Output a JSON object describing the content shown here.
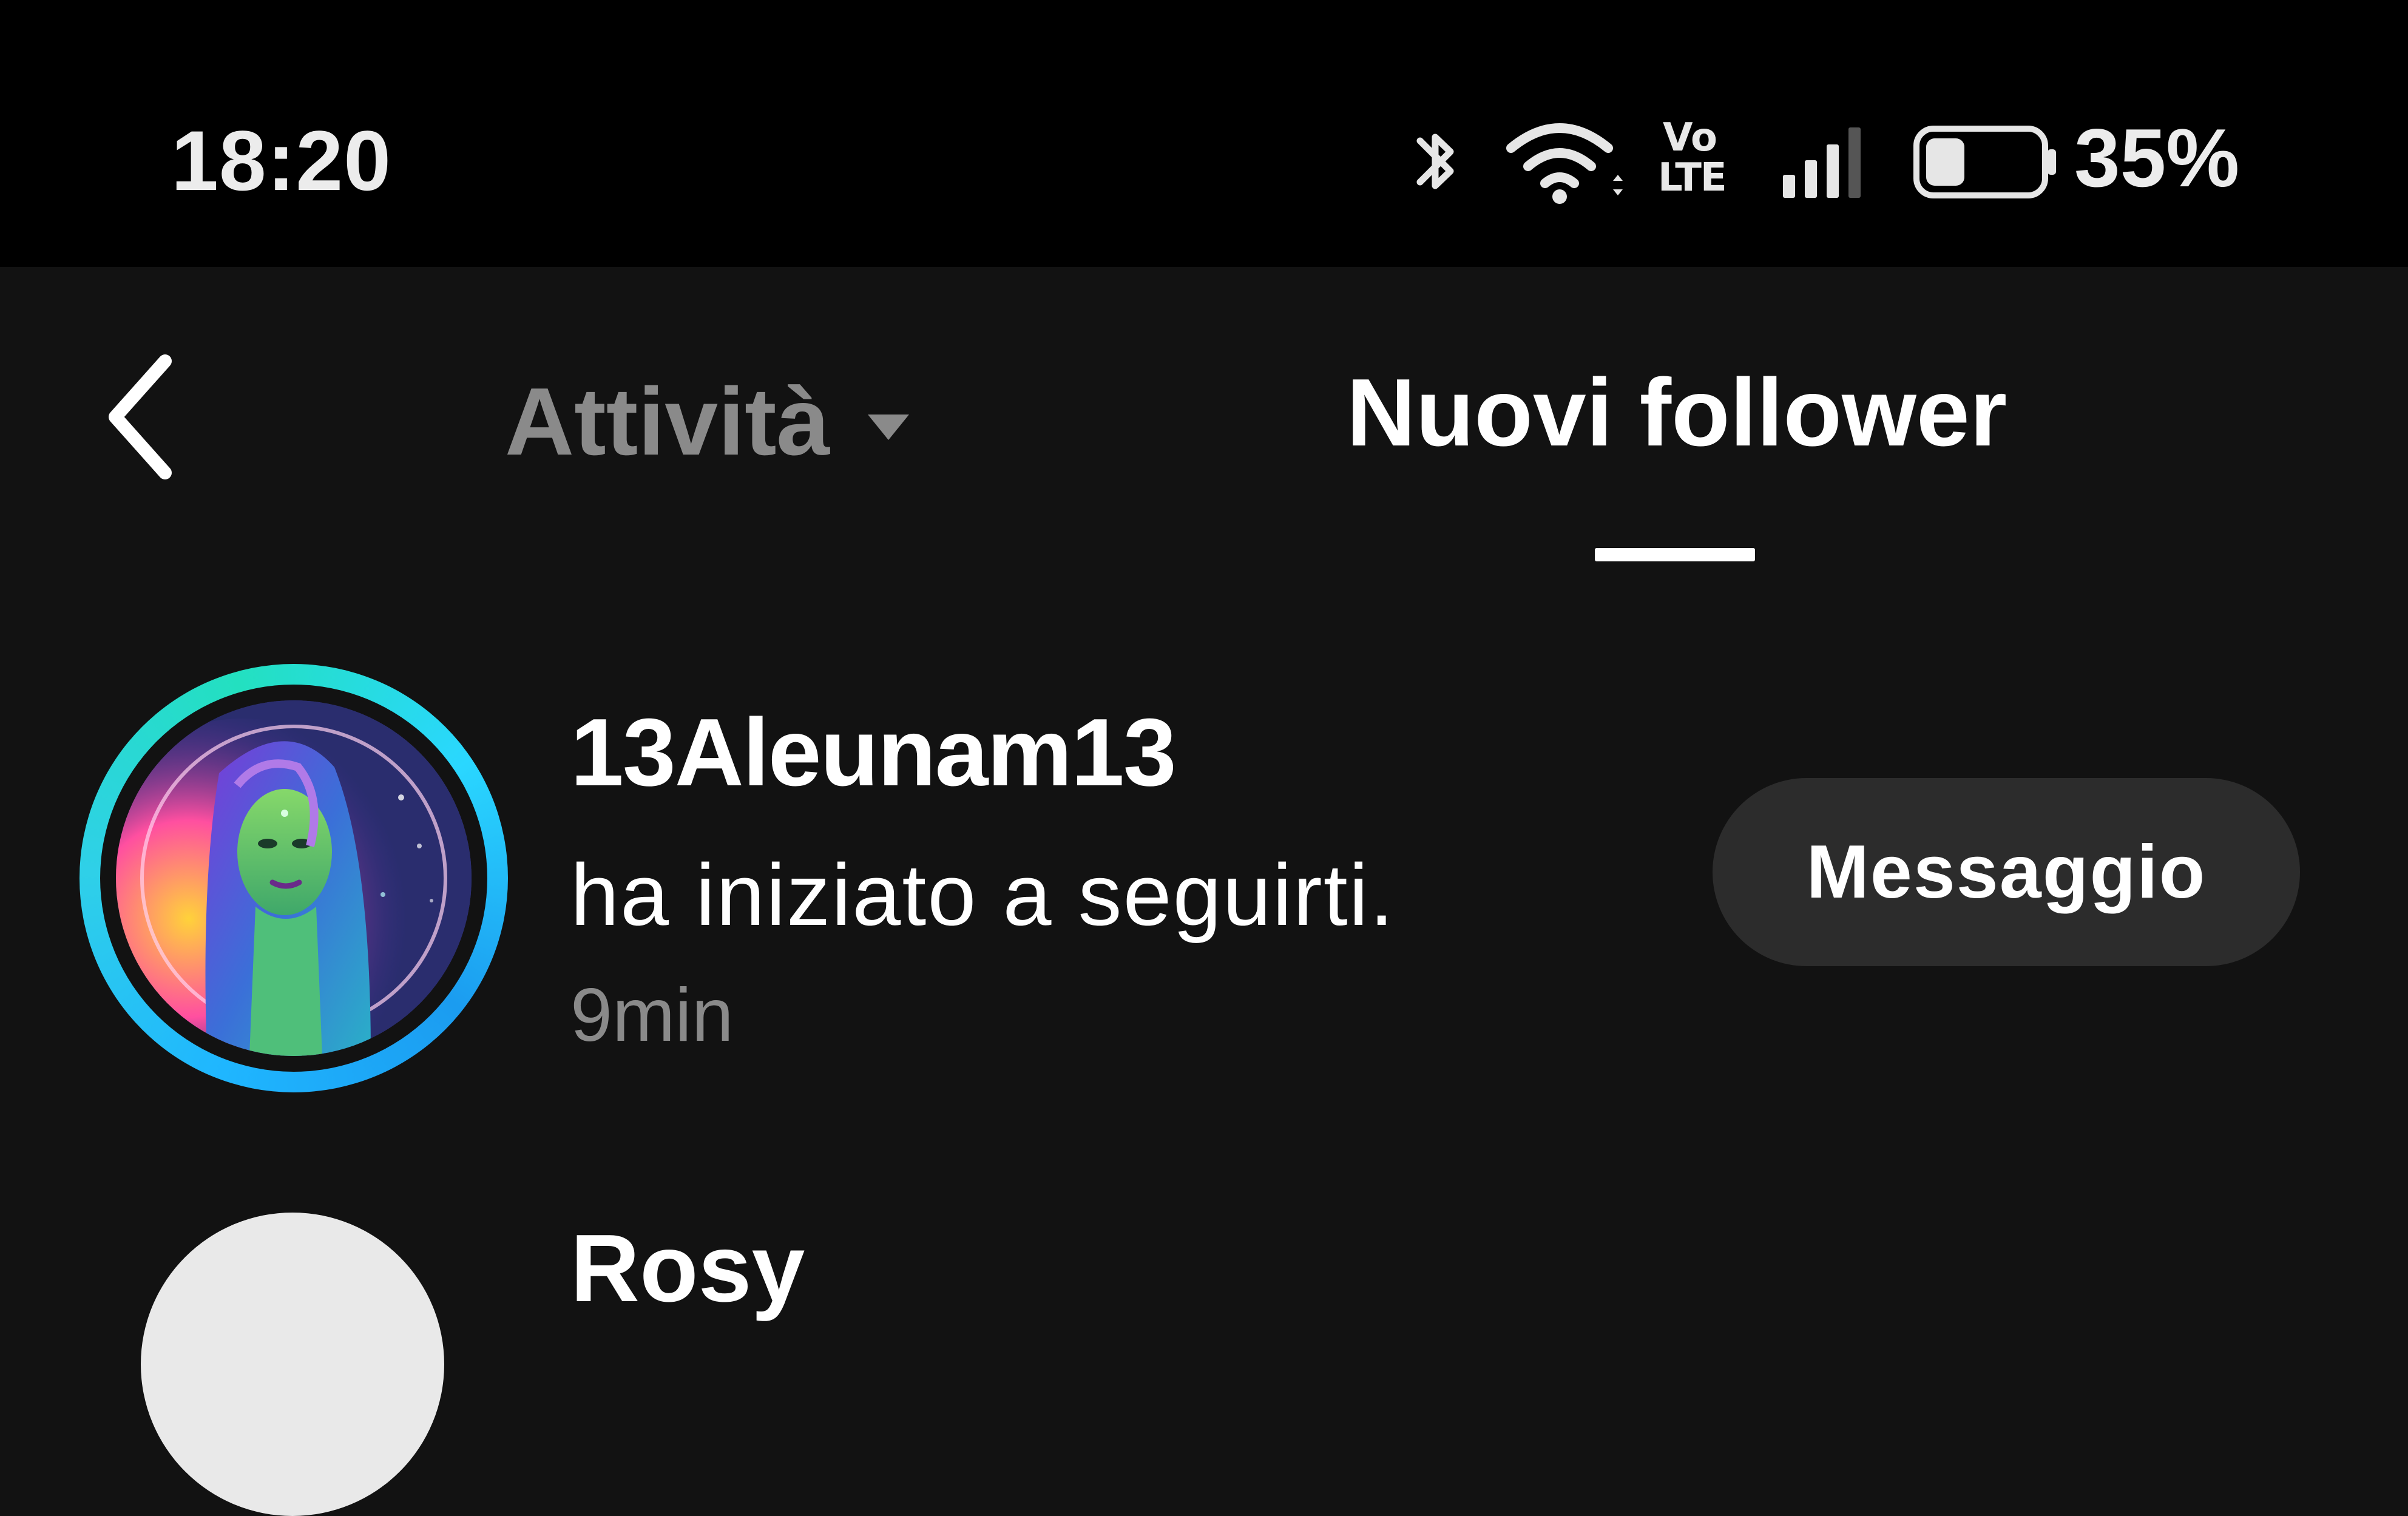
{
  "status_bar": {
    "time": "18:20",
    "battery_percent_text": "35%",
    "battery_level": 0.35,
    "volte_top": "Vo",
    "volte_bottom": "LTE",
    "icons": [
      "bluetooth-icon",
      "wifi-icon",
      "volte-icon",
      "signal-icon",
      "battery-icon"
    ]
  },
  "header": {
    "back_icon": "chevron-left-icon",
    "tabs": [
      {
        "label": "Attività",
        "icon": "caret-down-icon",
        "active": false
      },
      {
        "label": "Nuovi follower",
        "active": true
      }
    ]
  },
  "list": {
    "items": [
      {
        "username": "13Aleunam13",
        "action": "ha iniziato a seguirti.",
        "time_ago": "9min",
        "button_label": "Messaggio"
      },
      {
        "username": "Rosy"
      }
    ]
  },
  "colors": {
    "background": "#121212",
    "status_bar": "#000000",
    "button_bg": "#2c2c2c",
    "muted_text": "#8a8a8a",
    "story_ring": "#1fb6ff"
  }
}
